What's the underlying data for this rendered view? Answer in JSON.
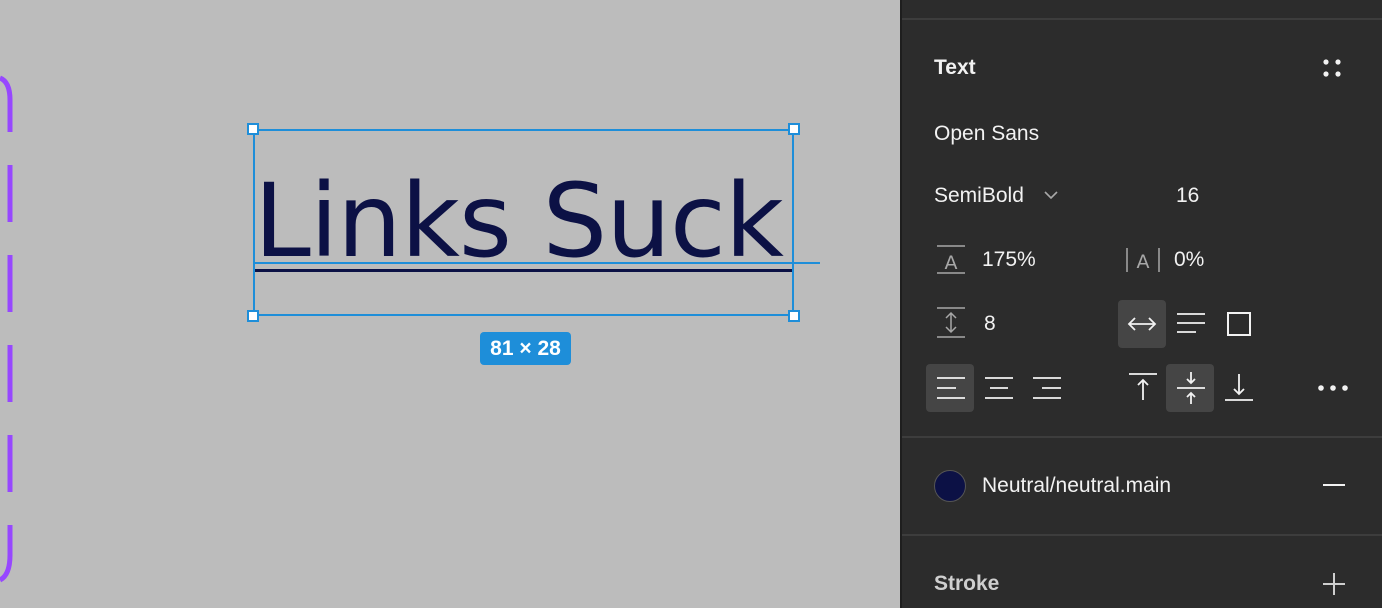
{
  "canvas": {
    "text_content": "Links Suck",
    "selection_dimensions": "81 × 28",
    "frame_border_color": "#9747ff",
    "selection_color": "#1e8ed9",
    "text_color": "#0c1145"
  },
  "panel": {
    "section_title": "Text",
    "font_family": "Open Sans",
    "font_weight": "SemiBold",
    "font_size": "16",
    "line_height": "175%",
    "letter_spacing": "0%",
    "paragraph_spacing": "8",
    "fill_style_name": "Neutral/neutral.main",
    "fill_color": "#0c1145",
    "stroke_title": "Stroke",
    "icons": {
      "styles": "four-dots-icon",
      "weight_dropdown": "chevron-down-icon",
      "line_height": "line-height-icon",
      "letter_spacing": "letter-spacing-icon",
      "paragraph_spacing": "paragraph-spacing-icon",
      "auto_width": "auto-width-icon",
      "auto_height": "auto-height-icon",
      "fixed_size": "fixed-size-icon",
      "align_left": "align-left-icon",
      "align_center": "align-center-icon",
      "align_right": "align-right-icon",
      "align_top": "align-top-icon",
      "align_middle": "align-middle-icon",
      "align_bottom": "align-bottom-icon",
      "more": "more-icon",
      "remove_fill": "minus-icon",
      "add_stroke": "plus-icon"
    }
  }
}
